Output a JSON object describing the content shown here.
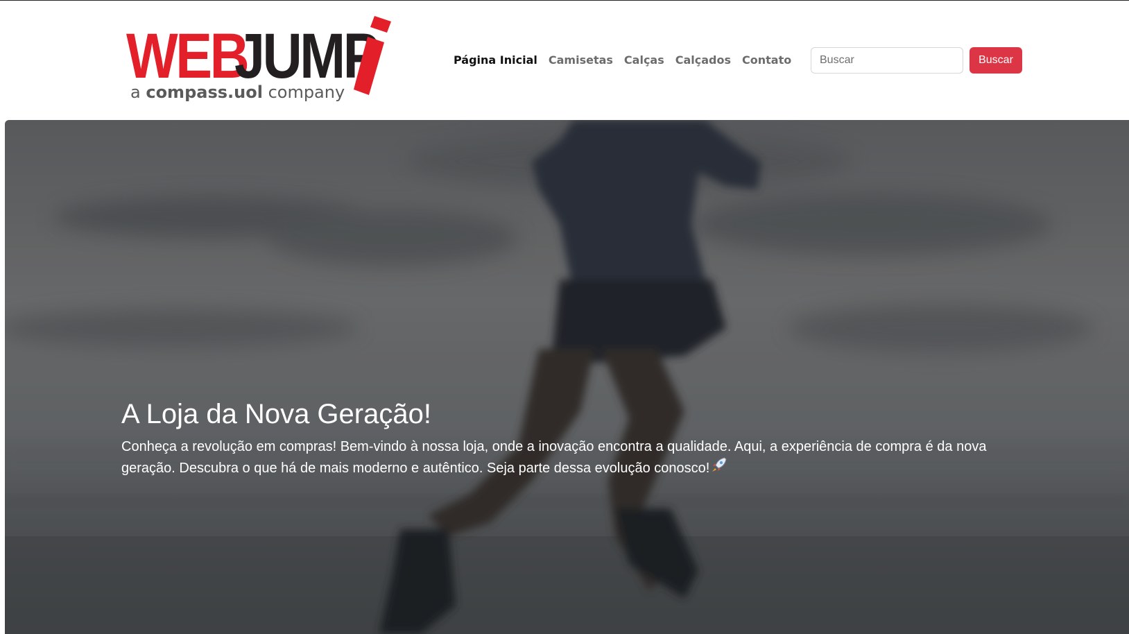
{
  "brand": {
    "logo_word_red": "WEB",
    "logo_word_dark": "JUMP",
    "tagline_prefix": "a ",
    "tagline_bold": "compass.uol",
    "tagline_suffix": " company",
    "color_red": "#e3202a",
    "color_dark": "#231f20"
  },
  "nav": {
    "items": [
      {
        "label": "Página Inicial",
        "active": true
      },
      {
        "label": "Camisetas",
        "active": false
      },
      {
        "label": "Calças",
        "active": false
      },
      {
        "label": "Calçados",
        "active": false
      },
      {
        "label": "Contato",
        "active": false
      }
    ]
  },
  "search": {
    "placeholder": "Buscar",
    "value": "",
    "button_label": "Buscar",
    "button_color": "#dc3545"
  },
  "hero": {
    "title": "A Loja da Nova Geração!",
    "text": "Conheça a revolução em compras! Bem-vindo à nossa loja, onde a inovação encontra a qualidade. Aqui, a experiência de compra é da nova geração. Descubra o que há de mais moderno e autêntico. Seja parte dessa evolução conosco!",
    "emoji_icon": "rocket-icon",
    "background_image": "runner-on-beach-photo"
  }
}
